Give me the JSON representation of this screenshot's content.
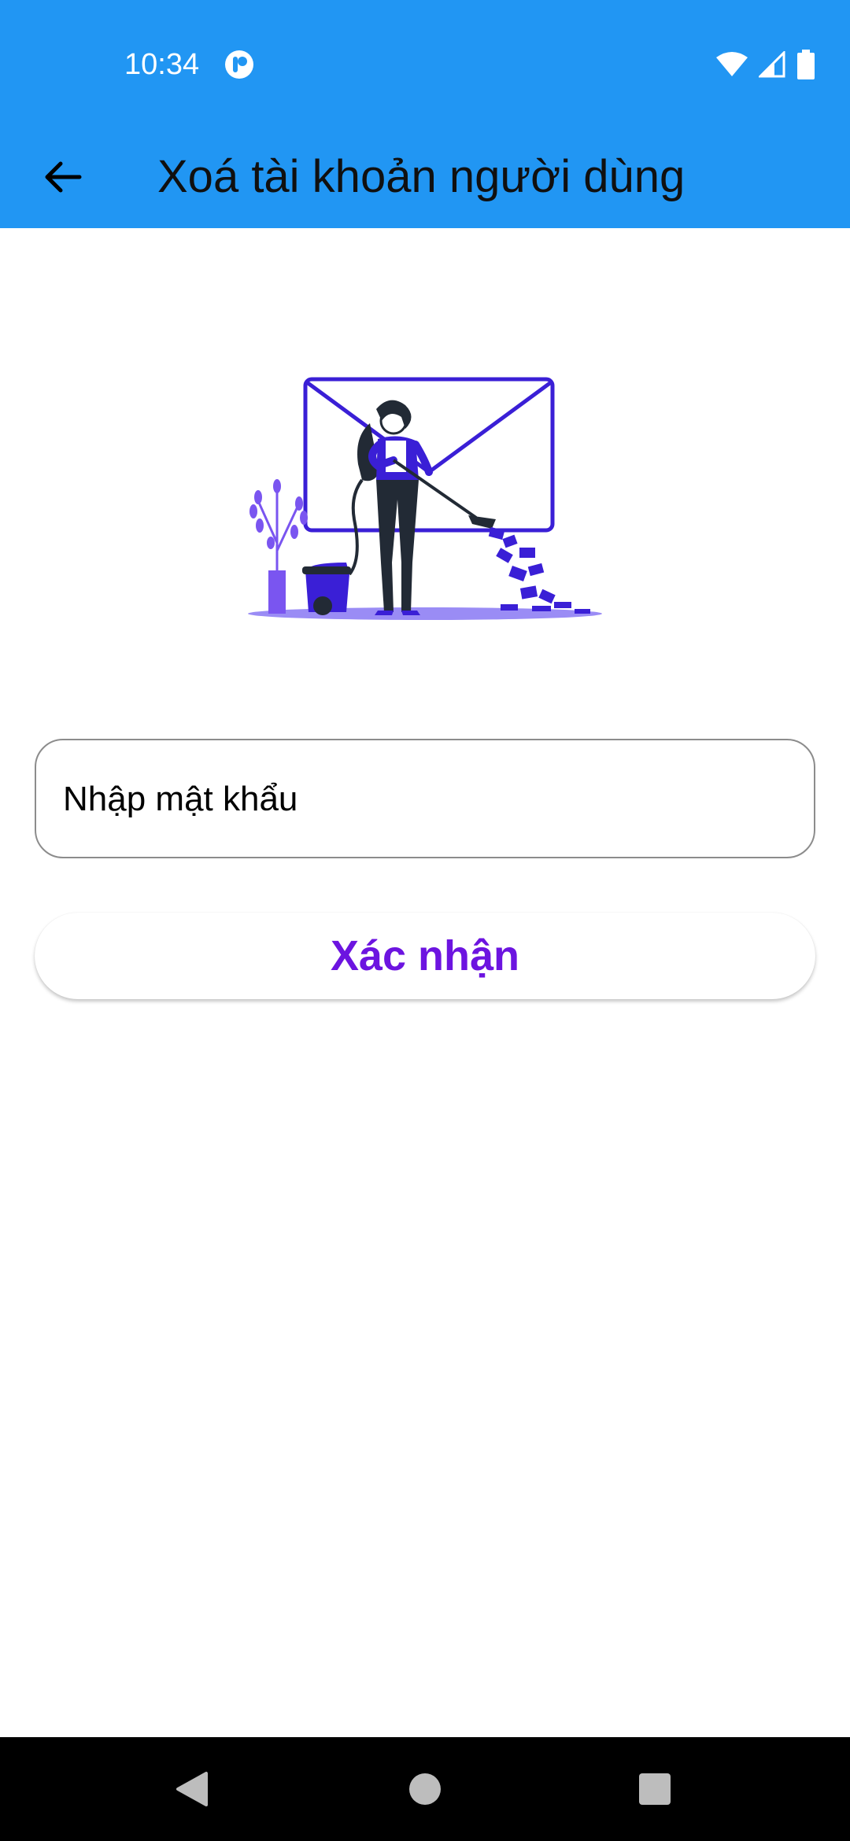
{
  "status_bar": {
    "time": "10:34",
    "app_icon": "notification-app-icon",
    "icons": [
      "wifi-icon",
      "signal-icon",
      "battery-icon"
    ]
  },
  "app_bar": {
    "back_icon": "arrow-left-icon",
    "title": "Xoá tài khoản người dùng",
    "background_color": "#2196F3"
  },
  "illustration": {
    "icon": "sweeping-envelope-illustration"
  },
  "form": {
    "password_placeholder": "Nhập mật khẩu",
    "password_value": "",
    "confirm_label": "Xác nhận",
    "confirm_color": "#6c14e0"
  },
  "nav_bar": {
    "icons": [
      "back-triangle-icon",
      "home-circle-icon",
      "recents-square-icon"
    ]
  }
}
